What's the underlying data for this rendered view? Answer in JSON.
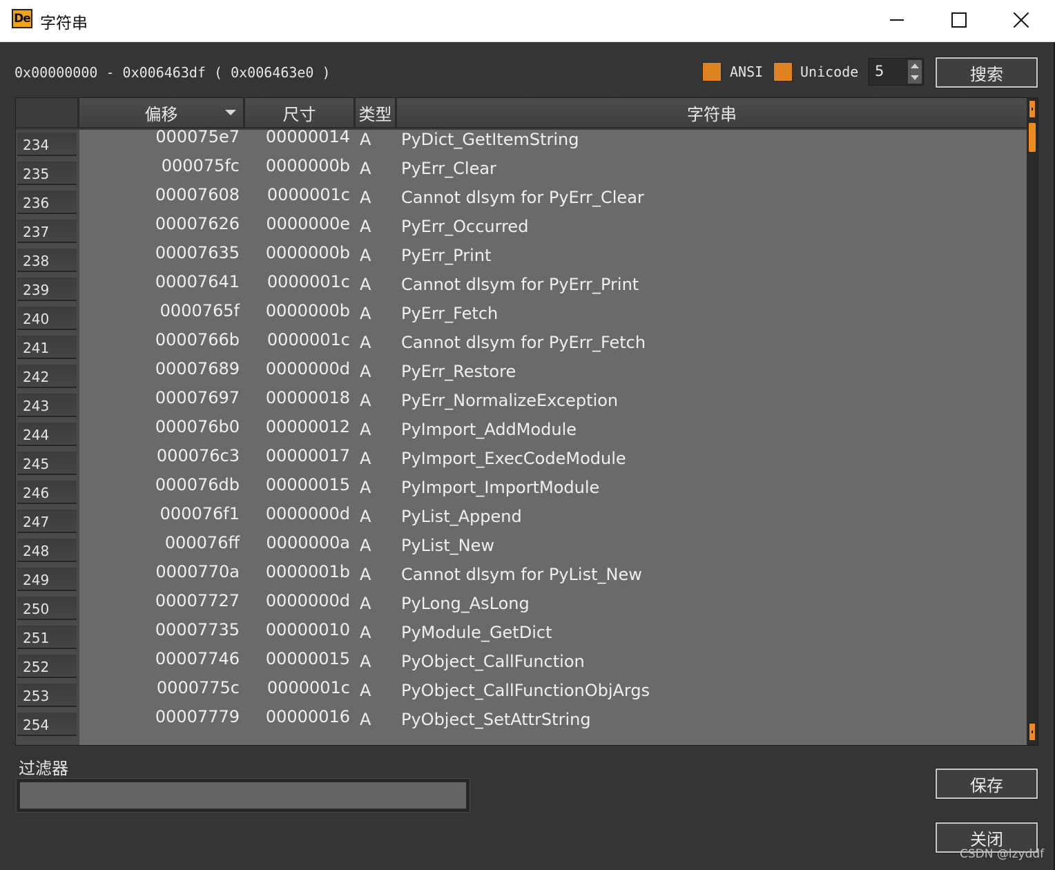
{
  "window": {
    "icon_text": "De",
    "title": "字符串"
  },
  "toolbar": {
    "range": "0x00000000 - 0x006463df ( 0x006463e0 )",
    "ansi_label": "ANSI",
    "unicode_label": "Unicode",
    "min_length": "5",
    "search_button": "搜索",
    "accent_color": "#e0821f"
  },
  "table": {
    "columns": [
      "偏移",
      "尺寸",
      "类型",
      "字符串"
    ],
    "sorted_column": "偏移",
    "rows": [
      {
        "n": "234",
        "offset": "000075e7",
        "size": "00000014",
        "type": "A",
        "string": "PyDict_GetItemString"
      },
      {
        "n": "235",
        "offset": "000075fc",
        "size": "0000000b",
        "type": "A",
        "string": "PyErr_Clear"
      },
      {
        "n": "236",
        "offset": "00007608",
        "size": "0000001c",
        "type": "A",
        "string": "Cannot dlsym for PyErr_Clear"
      },
      {
        "n": "237",
        "offset": "00007626",
        "size": "0000000e",
        "type": "A",
        "string": "PyErr_Occurred"
      },
      {
        "n": "238",
        "offset": "00007635",
        "size": "0000000b",
        "type": "A",
        "string": "PyErr_Print"
      },
      {
        "n": "239",
        "offset": "00007641",
        "size": "0000001c",
        "type": "A",
        "string": "Cannot dlsym for PyErr_Print"
      },
      {
        "n": "240",
        "offset": "0000765f",
        "size": "0000000b",
        "type": "A",
        "string": "PyErr_Fetch"
      },
      {
        "n": "241",
        "offset": "0000766b",
        "size": "0000001c",
        "type": "A",
        "string": "Cannot dlsym for PyErr_Fetch"
      },
      {
        "n": "242",
        "offset": "00007689",
        "size": "0000000d",
        "type": "A",
        "string": "PyErr_Restore"
      },
      {
        "n": "243",
        "offset": "00007697",
        "size": "00000018",
        "type": "A",
        "string": "PyErr_NormalizeException"
      },
      {
        "n": "244",
        "offset": "000076b0",
        "size": "00000012",
        "type": "A",
        "string": "PyImport_AddModule"
      },
      {
        "n": "245",
        "offset": "000076c3",
        "size": "00000017",
        "type": "A",
        "string": "PyImport_ExecCodeModule"
      },
      {
        "n": "246",
        "offset": "000076db",
        "size": "00000015",
        "type": "A",
        "string": "PyImport_ImportModule"
      },
      {
        "n": "247",
        "offset": "000076f1",
        "size": "0000000d",
        "type": "A",
        "string": "PyList_Append"
      },
      {
        "n": "248",
        "offset": "000076ff",
        "size": "0000000a",
        "type": "A",
        "string": "PyList_New"
      },
      {
        "n": "249",
        "offset": "0000770a",
        "size": "0000001b",
        "type": "A",
        "string": "Cannot dlsym for PyList_New"
      },
      {
        "n": "250",
        "offset": "00007727",
        "size": "0000000d",
        "type": "A",
        "string": "PyLong_AsLong"
      },
      {
        "n": "251",
        "offset": "00007735",
        "size": "00000010",
        "type": "A",
        "string": "PyModule_GetDict"
      },
      {
        "n": "252",
        "offset": "00007746",
        "size": "00000015",
        "type": "A",
        "string": "PyObject_CallFunction"
      },
      {
        "n": "253",
        "offset": "0000775c",
        "size": "0000001c",
        "type": "A",
        "string": "PyObject_CallFunctionObjArgs"
      },
      {
        "n": "254",
        "offset": "00007779",
        "size": "00000016",
        "type": "A",
        "string": "PyObject_SetAttrString"
      }
    ]
  },
  "filter": {
    "label": "过滤器",
    "value": ""
  },
  "buttons": {
    "save": "保存",
    "close": "关闭"
  },
  "watermark": "CSDN @lzyddf"
}
